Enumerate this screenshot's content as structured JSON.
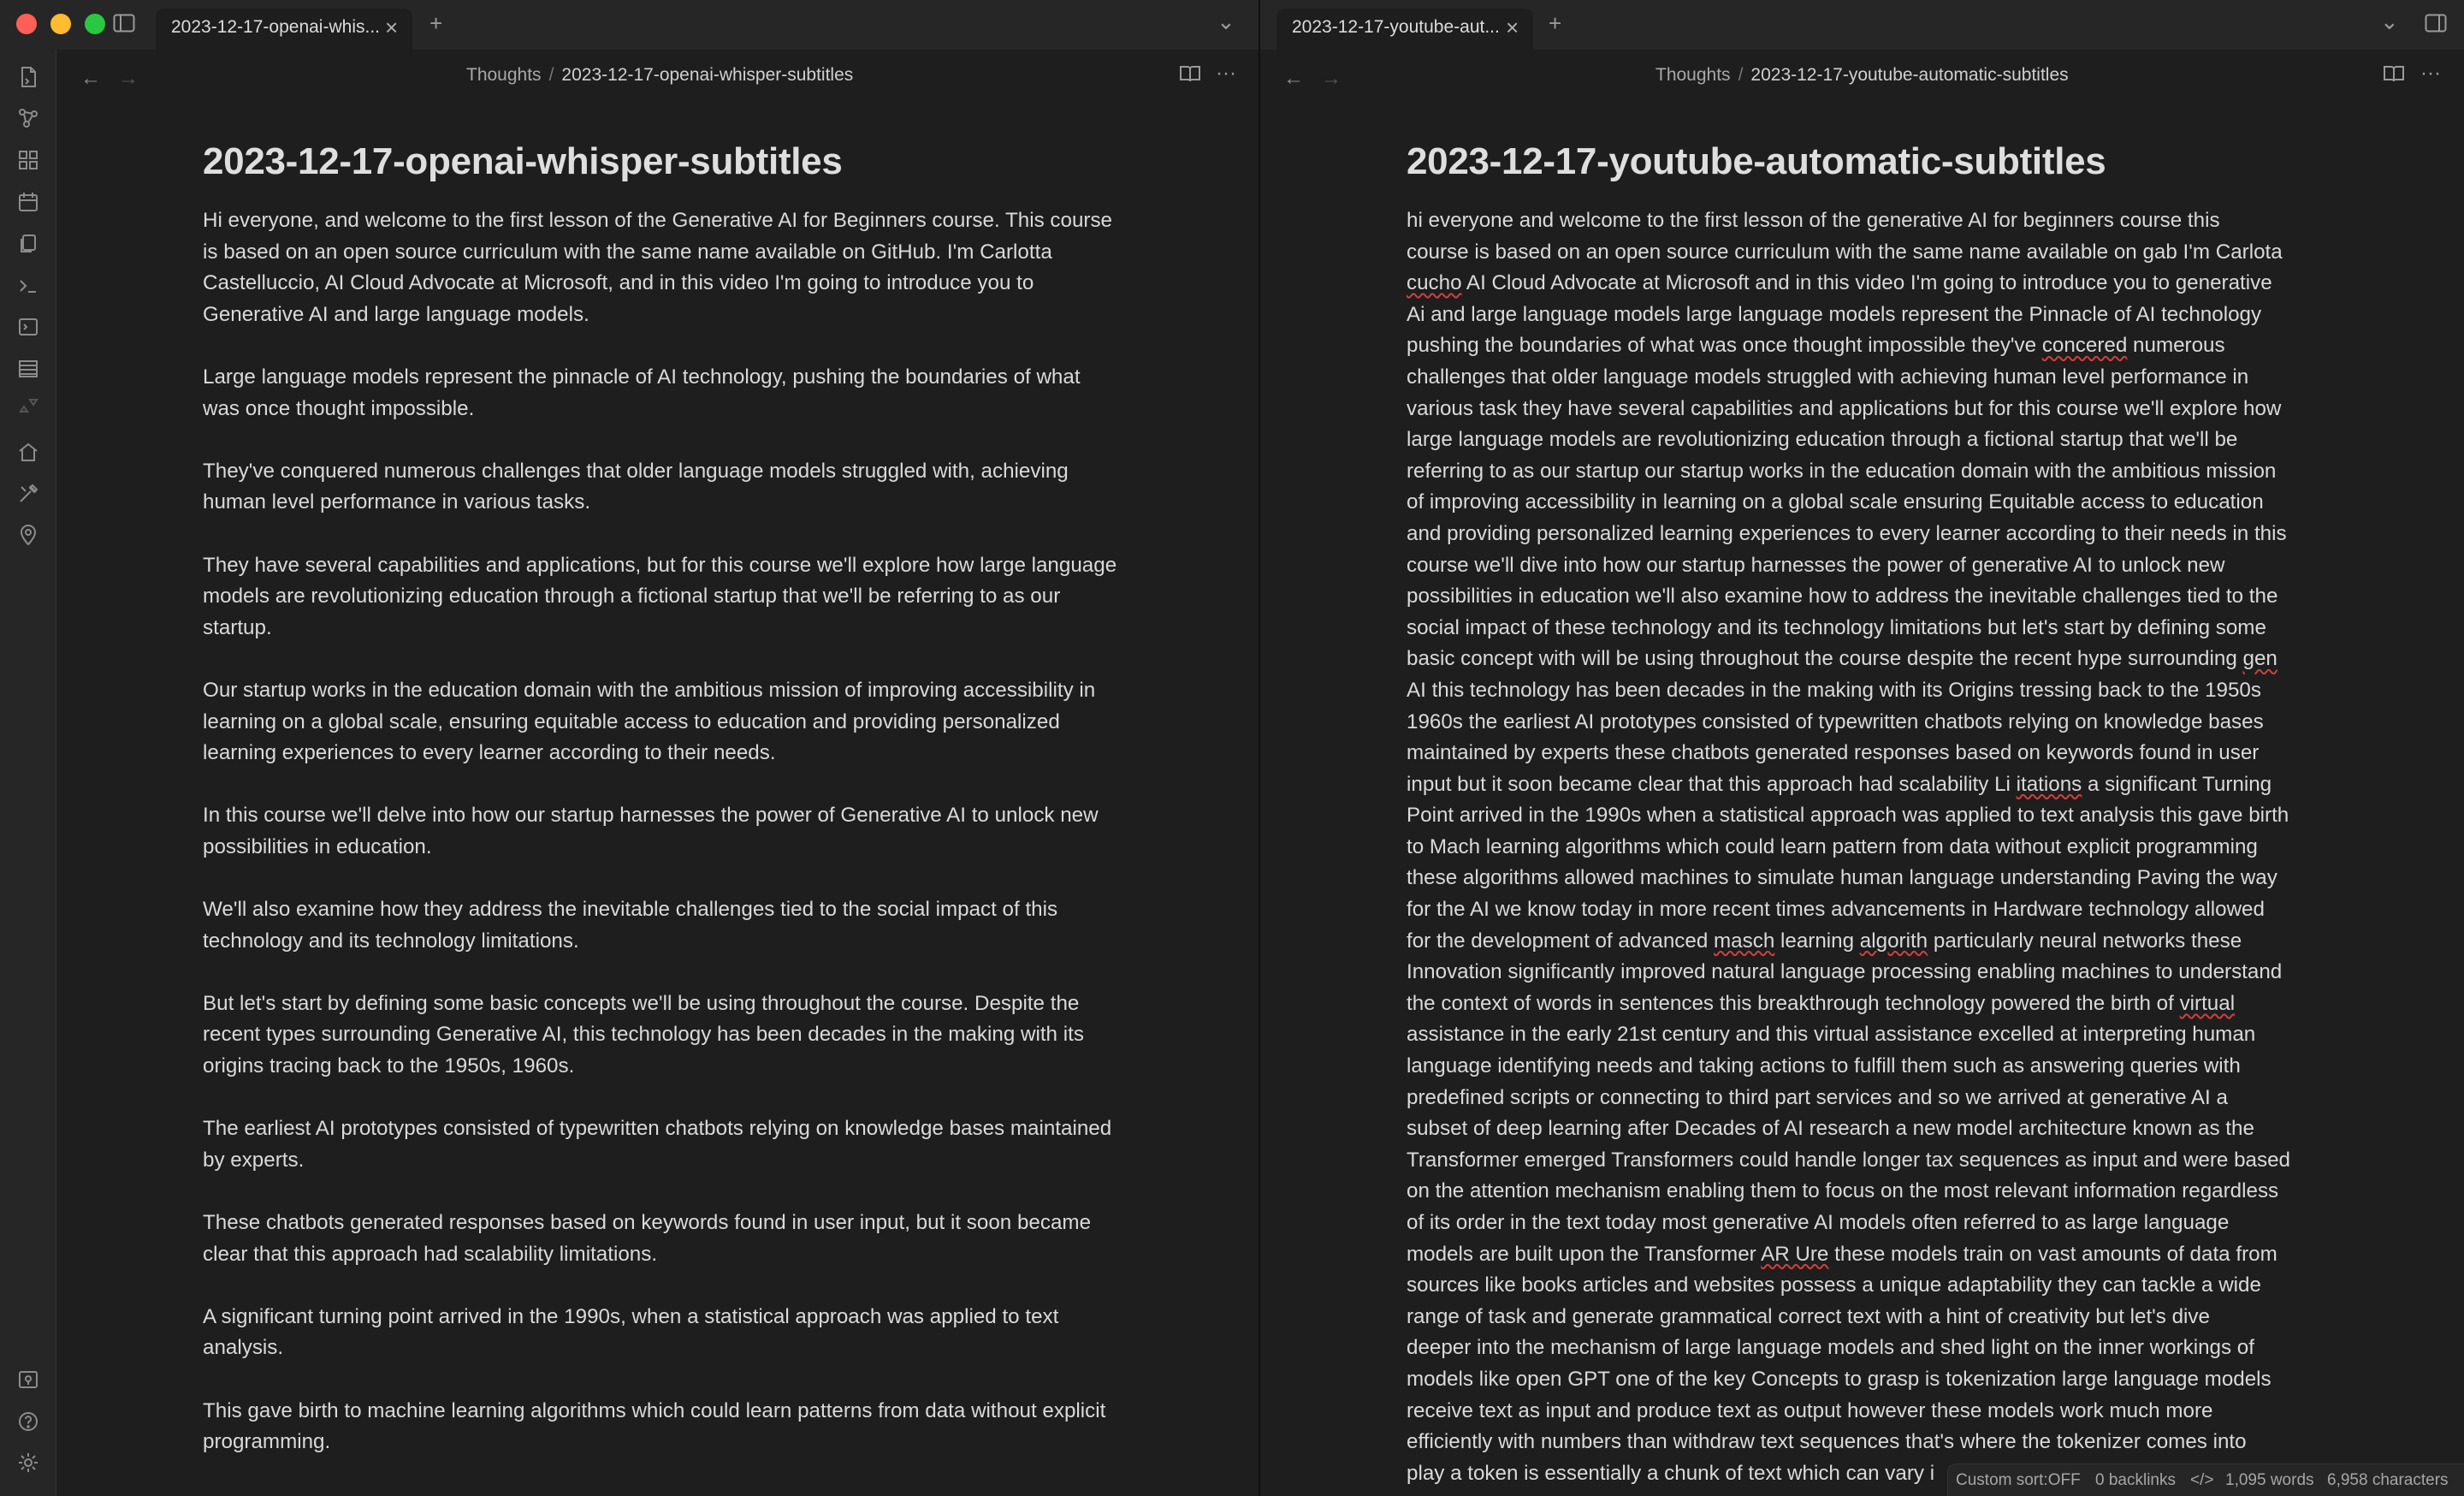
{
  "tabs": {
    "left": {
      "title": "2023-12-17-openai-whis...",
      "close": "×",
      "new": "+",
      "list": "⌄"
    },
    "right": {
      "title": "2023-12-17-youtube-aut...",
      "close": "×",
      "new": "+",
      "list": "⌄"
    }
  },
  "left_pane": {
    "breadcrumb": {
      "folder": "Thoughts",
      "sep": "/",
      "note": "2023-12-17-openai-whisper-subtitles"
    },
    "title": "2023-12-17-openai-whisper-subtitles",
    "paragraphs": [
      "Hi everyone, and welcome to the first lesson of the Generative AI for Beginners course. This course is based on an open source curriculum with the same name available on GitHub. I'm Carlotta Castelluccio, AI Cloud Advocate at Microsoft, and in this video I'm going to introduce you to Generative AI and large language models.",
      "Large language models represent the pinnacle of AI technology, pushing the boundaries of what was once thought impossible.",
      "They've conquered numerous challenges that older language models struggled with, achieving human level performance in various tasks.",
      "They have several capabilities and applications, but for this course we'll explore how large language models are revolutionizing education through a fictional startup that we'll be referring to as our startup.",
      "Our startup works in the education domain with the ambitious mission of improving accessibility in learning on a global scale, ensuring equitable access to education and providing personalized learning experiences to every learner according to their needs.",
      "In this course we'll delve into how our startup harnesses the power of Generative AI to unlock new possibilities in education.",
      "We'll also examine how they address the inevitable challenges tied to the social impact of this technology and its technology limitations.",
      "But let's start by defining some basic concepts we'll be using throughout the course. Despite the recent types surrounding Generative AI, this technology has been decades in the making with its origins tracing back to the 1950s, 1960s.",
      "The earliest AI prototypes consisted of typewritten chatbots relying on knowledge bases maintained by experts.",
      "These chatbots generated responses based on keywords found in user input, but it soon became clear that this approach had scalability limitations.",
      "A significant turning point arrived in the 1990s, when a statistical approach was applied to text analysis.",
      "This gave birth to machine learning algorithms which could learn patterns from data without explicit programming."
    ]
  },
  "right_pane": {
    "breadcrumb": {
      "folder": "Thoughts",
      "sep": "/",
      "note": "2023-12-17-youtube-automatic-subtitles"
    },
    "title": "2023-12-17-youtube-automatic-subtitles",
    "lines": [
      [
        {
          "t": "hi everyone and welcome to the first lesson of the generative AI for beginners course this"
        }
      ],
      [
        {
          "t": "course is based on an open source curriculum with the same name available on gab I'm Carlota"
        }
      ],
      [
        {
          "t": "cucho",
          "s": true
        },
        {
          "t": " AI Cloud Advocate at Microsoft and in this video I'm going to introduce you to generative"
        }
      ],
      [
        {
          "t": "Ai and large language models large language models represent the Pinnacle of AI technology"
        }
      ],
      [
        {
          "t": "pushing the boundaries of what was once thought impossible they've "
        },
        {
          "t": "concered",
          "s": true
        },
        {
          "t": " numerous"
        }
      ],
      [
        {
          "t": "challenges that older language models struggled with achieving human level performance in"
        }
      ],
      [
        {
          "t": "various task they have several capabilities and applications but for this course we'll explore how"
        }
      ],
      [
        {
          "t": "large language models are revolutionizing education through a fictional startup that we'll be"
        }
      ],
      [
        {
          "t": "referring to as our startup our startup works in the education domain with the ambitious mission"
        }
      ],
      [
        {
          "t": "of improving accessibility in learning on a global scale ensuring Equitable access to education"
        }
      ],
      [
        {
          "t": "and providing personalized learning experiences to every learner according to their needs in this"
        }
      ],
      [
        {
          "t": "course we'll dive into how our startup harnesses the power of generative AI to unlock new"
        }
      ],
      [
        {
          "t": "possibilities in education we'll also examine how to address the inevitable challenges tied to the"
        }
      ],
      [
        {
          "t": "social impact of these technology and its technology limitations but let's start by defining some"
        }
      ],
      [
        {
          "t": "basic concept with will be using throughout the course despite the recent hype surrounding "
        },
        {
          "t": "gen",
          "s": true
        }
      ],
      [
        {
          "t": "AI this technology has been decades in the making with its Origins tressing back to the 1950s"
        }
      ],
      [
        {
          "t": "1960s the earliest AI prototypes consisted of typewritten chatbots relying on knowledge bases"
        }
      ],
      [
        {
          "t": "maintained by experts these chatbots generated responses based on keywords found in user"
        }
      ],
      [
        {
          "t": "input but it soon became clear that this approach had scalability Li "
        },
        {
          "t": "itations",
          "s": true
        },
        {
          "t": " a significant Turning"
        }
      ],
      [
        {
          "t": "Point arrived in the 1990s when a statistical approach was applied to text analysis this gave birth"
        }
      ],
      [
        {
          "t": "to Mach learning algorithms which could learn pattern from data without explicit programming"
        }
      ],
      [
        {
          "t": "these algorithms allowed machines to simulate human language understanding Paving the way"
        }
      ],
      [
        {
          "t": "for the AI we know today in more recent times advancements in Hardware technology allowed"
        }
      ],
      [
        {
          "t": "for the development of advanced "
        },
        {
          "t": "masch",
          "s": true
        },
        {
          "t": " learning "
        },
        {
          "t": "algorith",
          "s": true
        },
        {
          "t": " particularly neural networks these"
        }
      ],
      [
        {
          "t": "Innovation significantly improved natural language processing enabling machines to understand"
        }
      ],
      [
        {
          "t": "the context of words in sentences this breakthrough technology powered the birth of "
        },
        {
          "t": "virtual",
          "s": true
        }
      ],
      [
        {
          "t": "assistance in the early 21st century and this virtual assistance excelled at interpreting human"
        }
      ],
      [
        {
          "t": "language identifying needs and taking actions to fulfill them such as answering queries with"
        }
      ],
      [
        {
          "t": "predefined scripts or connecting to third part services and so we arrived at generative AI a"
        }
      ],
      [
        {
          "t": "subset of deep learning after Decades of AI research a new model architecture known as the"
        }
      ],
      [
        {
          "t": "Transformer emerged Transformers could handle longer tax sequences as input and were based"
        }
      ],
      [
        {
          "t": "on the attention mechanism enabling them to focus on the most relevant information regardless"
        }
      ],
      [
        {
          "t": "of its order in the text today most generative AI models often referred to as large language"
        }
      ],
      [
        {
          "t": "models are built upon the Transformer "
        },
        {
          "t": "AR Ure",
          "s": true
        },
        {
          "t": " these models train on vast amounts of data from"
        }
      ],
      [
        {
          "t": "sources like books articles and websites possess a unique adaptability they can tackle a wide"
        }
      ],
      [
        {
          "t": "range of task and generate grammatical correct text with a hint of creativity but let's dive"
        }
      ],
      [
        {
          "t": "deeper into the mechanism of large language models and shed light on the inner workings of"
        }
      ],
      [
        {
          "t": "models like open GPT one of the key Concepts to grasp is tokenization large language models"
        }
      ],
      [
        {
          "t": "receive text as input and produce text as output however these models work much more"
        }
      ],
      [
        {
          "t": "efficiently with numbers than withdraw text sequences that's where the tokenizer comes into"
        }
      ],
      [
        {
          "t": "play a token is essentially a chunk of text which can vary i"
        }
      ]
    ]
  },
  "status": {
    "sort": "Custom sort:OFF",
    "backlinks": "0 backlinks",
    "source_icon": "</>",
    "words": "1,095 words",
    "chars": "6,958 characters"
  },
  "icons": {
    "sidebar_toggle": "sidebar-left-icon",
    "back": "←",
    "forward": "→",
    "reading_view": "book-open-icon",
    "more": "···"
  }
}
